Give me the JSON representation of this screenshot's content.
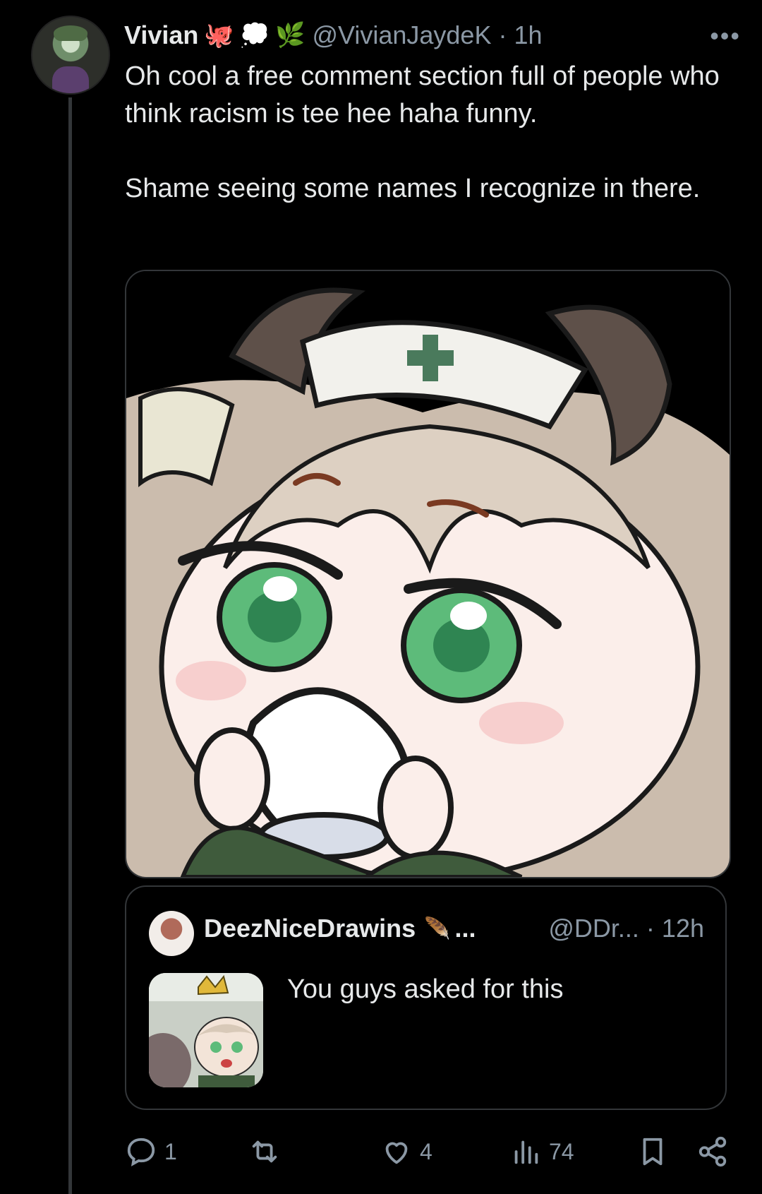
{
  "tweet": {
    "author_name": "Vivian",
    "author_emojis": [
      "🐙",
      "💭",
      "🌿"
    ],
    "handle": "@VivianJaydeK",
    "separator": "·",
    "time": "1h",
    "more": "•••",
    "text": "Oh cool a free comment section full of people who think racism is tee hee haha funny.\n\nShame seeing some names I recognize in there."
  },
  "quote": {
    "author_name": "DeezNiceDrawins",
    "emoji": "🪶",
    "ellipsis": "...",
    "handle": "@DDr...",
    "separator": "·",
    "time": "12h",
    "text": "You guys asked for this"
  },
  "actions": {
    "reply_count": "1",
    "repost_count": "",
    "like_count": "4",
    "views_count": "74"
  },
  "colors": {
    "background": "#000000",
    "text": "#e7e9ea",
    "secondary": "#8b98a5",
    "border": "#333639"
  },
  "icons": [
    "reply-icon",
    "repost-icon",
    "like-icon",
    "views-icon",
    "bookmark-icon",
    "share-icon"
  ]
}
